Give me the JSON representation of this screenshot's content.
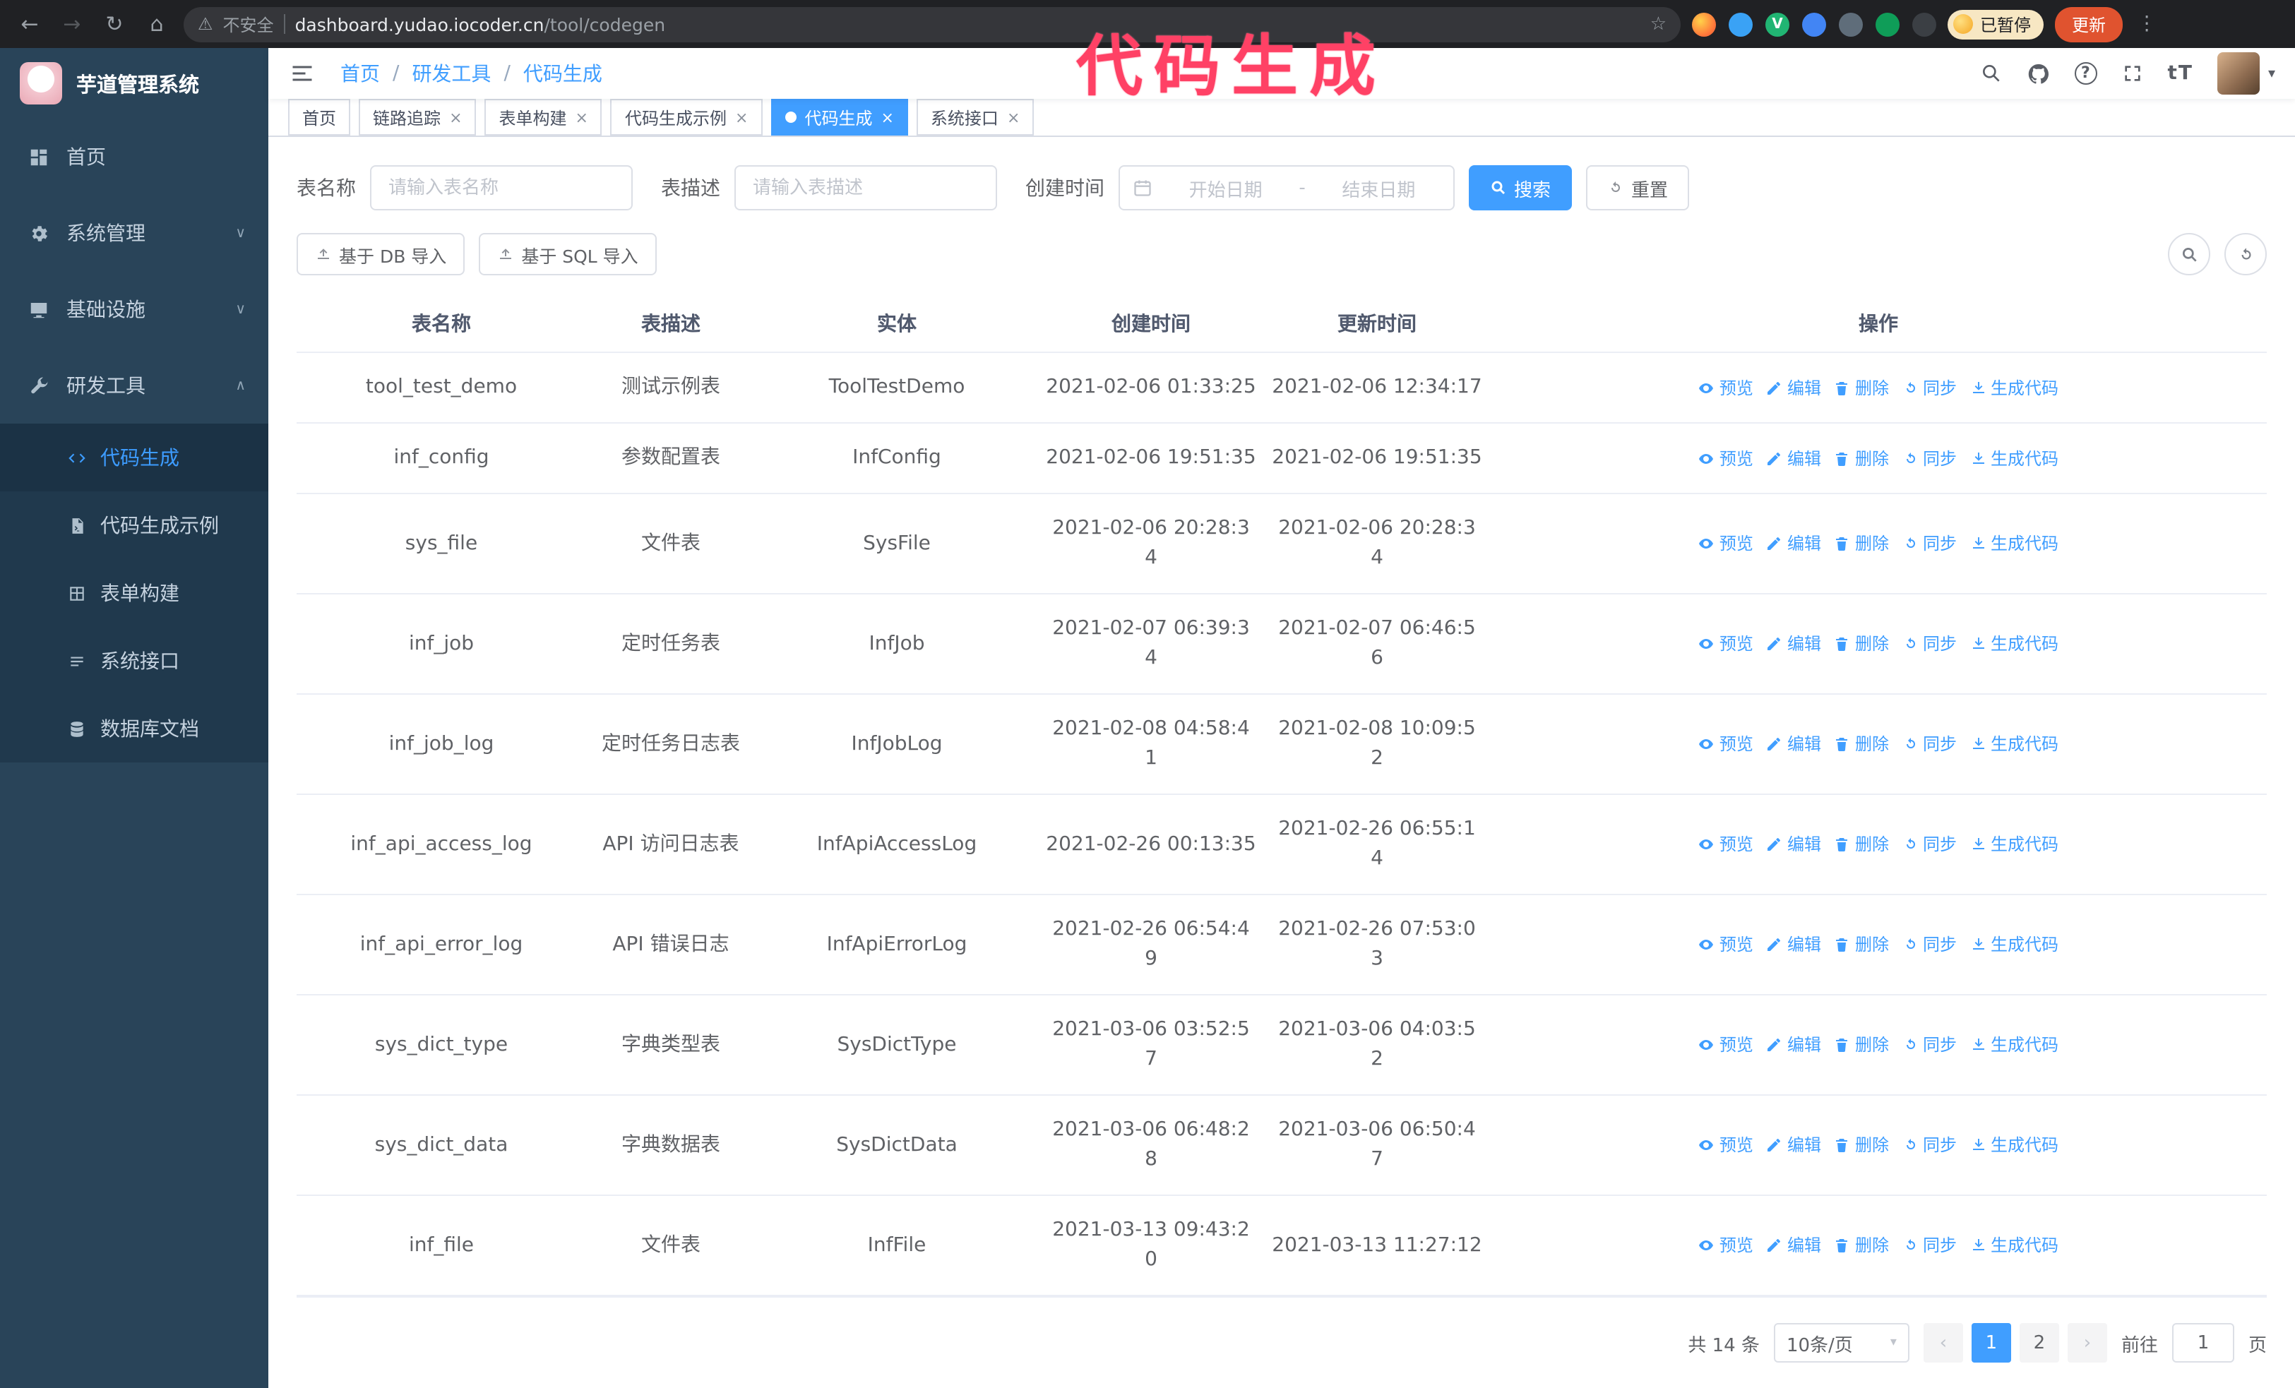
{
  "browser": {
    "security_label": "不安全",
    "url_host": "dashboard.yudao.iocoder.cn",
    "url_path": "/tool/codegen",
    "paused_badge": "已暂停",
    "update_button": "更新"
  },
  "annotation": {
    "text": "代码生成",
    "color": "#ff4165"
  },
  "sidebar": {
    "logo_title": "芋道管理系统",
    "items": [
      {
        "label": "首页"
      },
      {
        "label": "系统管理",
        "chevron": "∨"
      },
      {
        "label": "基础设施",
        "chevron": "∨"
      },
      {
        "label": "研发工具",
        "chevron": "∧"
      }
    ],
    "submenu": [
      {
        "label": "代码生成",
        "active": true
      },
      {
        "label": "代码生成示例"
      },
      {
        "label": "表单构建"
      },
      {
        "label": "系统接口"
      },
      {
        "label": "数据库文档"
      }
    ]
  },
  "header": {
    "breadcrumb": [
      "首页",
      "研发工具",
      "代码生成"
    ],
    "separator": "/"
  },
  "tabs": [
    {
      "label": "首页"
    },
    {
      "label": "链路追踪",
      "closable": true
    },
    {
      "label": "表单构建",
      "closable": true
    },
    {
      "label": "代码生成示例",
      "closable": true
    },
    {
      "label": "代码生成",
      "closable": true,
      "active": true
    },
    {
      "label": "系统接口",
      "closable": true
    }
  ],
  "filters": {
    "table_name_label": "表名称",
    "table_name_placeholder": "请输入表名称",
    "table_desc_label": "表描述",
    "table_desc_placeholder": "请输入表描述",
    "create_time_label": "创建时间",
    "date_start_placeholder": "开始日期",
    "date_separator": "-",
    "date_end_placeholder": "结束日期",
    "search_button": "搜索",
    "reset_button": "重置"
  },
  "toolbar": {
    "import_db_label": "基于 DB 导入",
    "import_sql_label": "基于 SQL 导入"
  },
  "table": {
    "columns": [
      "表名称",
      "表描述",
      "实体",
      "创建时间",
      "更新时间",
      "操作"
    ],
    "actions": {
      "preview": "预览",
      "edit": "编辑",
      "delete": "删除",
      "sync": "同步",
      "generate": "生成代码"
    },
    "rows": [
      {
        "name": "tool_test_demo",
        "desc": "测试示例表",
        "entity": "ToolTestDemo",
        "created": "2021-02-06 01:33:25",
        "updated": "2021-02-06 12:34:17"
      },
      {
        "name": "inf_config",
        "desc": "参数配置表",
        "entity": "InfConfig",
        "created": "2021-02-06 19:51:35",
        "updated": "2021-02-06 19:51:35"
      },
      {
        "name": "sys_file",
        "desc": "文件表",
        "entity": "SysFile",
        "created": "2021-02-06 20:28:3\n4",
        "updated": "2021-02-06 20:28:3\n4"
      },
      {
        "name": "inf_job",
        "desc": "定时任务表",
        "entity": "InfJob",
        "created": "2021-02-07 06:39:3\n4",
        "updated": "2021-02-07 06:46:5\n6"
      },
      {
        "name": "inf_job_log",
        "desc": "定时任务日志表",
        "entity": "InfJobLog",
        "created": "2021-02-08 04:58:4\n1",
        "updated": "2021-02-08 10:09:5\n2"
      },
      {
        "name": "inf_api_access_log",
        "desc": "API 访问日志表",
        "entity": "InfApiAccessLog",
        "created": "2021-02-26 00:13:35",
        "updated": "2021-02-26 06:55:1\n4"
      },
      {
        "name": "inf_api_error_log",
        "desc": "API 错误日志",
        "entity": "InfApiErrorLog",
        "created": "2021-02-26 06:54:4\n9",
        "updated": "2021-02-26 07:53:0\n3"
      },
      {
        "name": "sys_dict_type",
        "desc": "字典类型表",
        "entity": "SysDictType",
        "created": "2021-03-06 03:52:5\n7",
        "updated": "2021-03-06 04:03:5\n2"
      },
      {
        "name": "sys_dict_data",
        "desc": "字典数据表",
        "entity": "SysDictData",
        "created": "2021-03-06 06:48:2\n8",
        "updated": "2021-03-06 06:50:4\n7"
      },
      {
        "name": "inf_file",
        "desc": "文件表",
        "entity": "InfFile",
        "created": "2021-03-13 09:43:2\n0",
        "updated": "2021-03-13 11:27:12"
      }
    ]
  },
  "pagination": {
    "total_label": "共 14 条",
    "page_size_label": "10条/页",
    "pages": [
      "1",
      "2"
    ],
    "goto_label": "前往",
    "goto_value": "1",
    "goto_unit": "页"
  },
  "colors": {
    "accent": "#409eff",
    "sidebar_bg": "#294459",
    "annotation": "#ff4165",
    "update_button": "#e0532f"
  }
}
